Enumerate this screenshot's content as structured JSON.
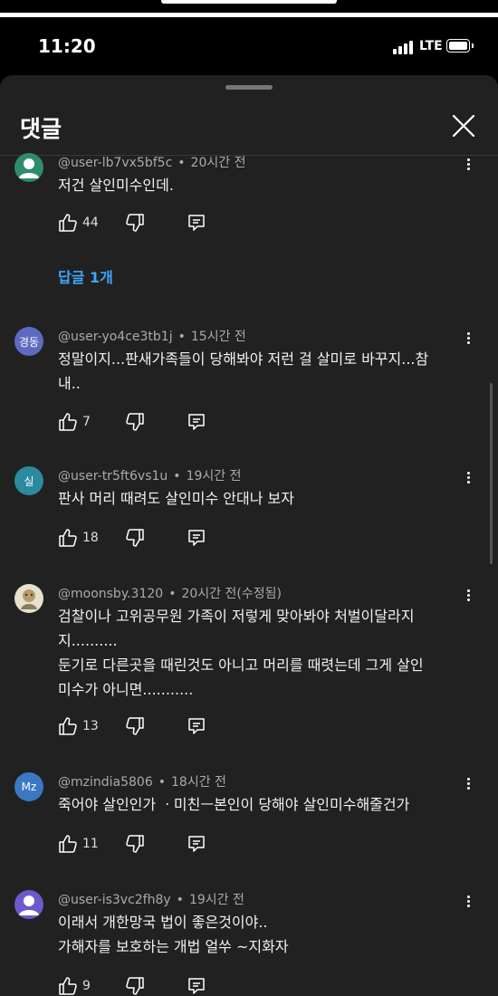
{
  "status_bar": {
    "time": "11:20",
    "network": "LTE"
  },
  "sheet": {
    "title": "댓글"
  },
  "comments": [
    {
      "author": "@user-lb7vx5bf5c",
      "time": "20시간 전",
      "text": "저건 살인미수인데.",
      "likes": "44",
      "avatar_text": "",
      "avatar_color": "#2f8b6d",
      "reply_label": "답글 1개"
    },
    {
      "author": "@user-yo4ce3tb1j",
      "time": "15시간 전",
      "text": "정말이지...판새가족들이 당해봐야 저런 걸 살미로 바꾸지...참\n내..",
      "likes": "7",
      "avatar_text": "경동",
      "avatar_color": "#5c6bc0"
    },
    {
      "author": "@user-tr5ft6vs1u",
      "time": "19시간 전",
      "text": "판사 머리 때려도 살인미수 안대나 보자",
      "likes": "18",
      "avatar_text": "실",
      "avatar_color": "#2b8aa0"
    },
    {
      "author": "@moonsby.3120",
      "time": "20시간 전(수정됨)",
      "text": "검찰이나 고위공무원 가족이 저렇게 맞아봐야 처벌이달라지\n지..........\n둔기로 다른곳을 때린것도 아니고 머리를 때렷는데 그게 살인\n미수가 아니면...........",
      "likes": "13",
      "avatar_text": "",
      "avatar_color": "#e6e0cf"
    },
    {
      "author": "@mzindia5806",
      "time": "18시간 전",
      "text": "죽어야 살인인가 ㆍ미친ㅡ본인이 당해야 살인미수해줄건가",
      "likes": "11",
      "avatar_text": "Mz",
      "avatar_color": "#3b78c4"
    },
    {
      "author": "@user-is3vc2fh8y",
      "time": "19시간 전",
      "text": "이래서 개한망국 법이 좋은것이야..\n가해자를 보호하는 개법 얼쑤 ~지화자",
      "likes": "9",
      "avatar_text": "",
      "avatar_color": "#6a5acd"
    }
  ],
  "icons": {
    "like": "thumbs-up-icon",
    "dislike": "thumbs-down-icon",
    "reply": "reply-comment-icon",
    "more": "more-vertical-icon",
    "close": "close-icon"
  },
  "colors": {
    "background": "#212121",
    "link": "#3ea6ff"
  }
}
